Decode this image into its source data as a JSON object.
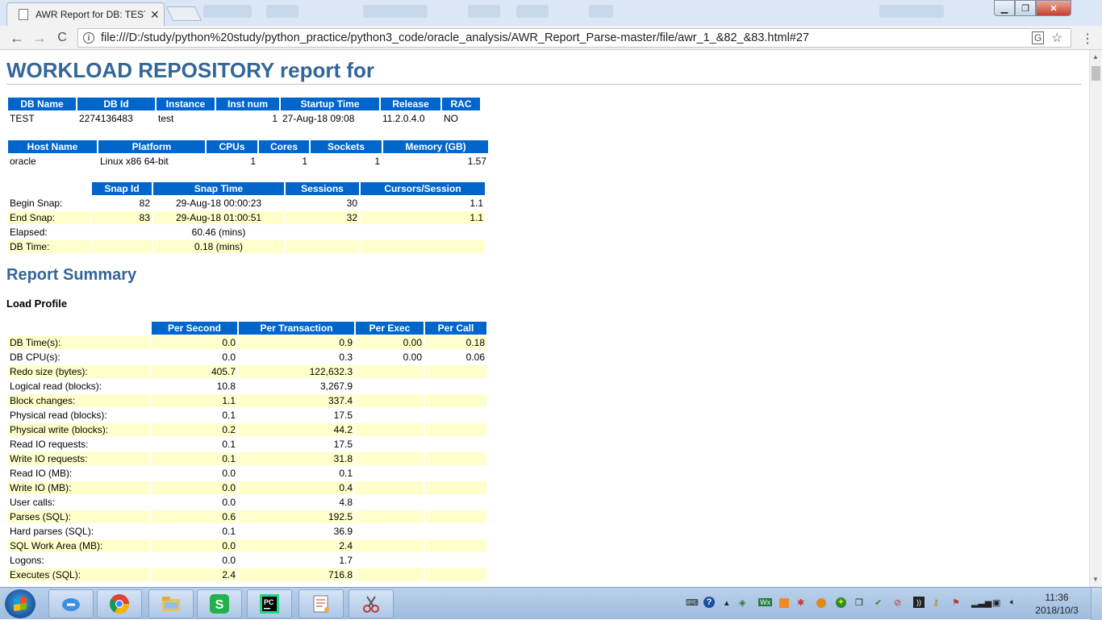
{
  "browser": {
    "tab_title": "AWR Report for DB: TEST",
    "tab_close": "✕",
    "url": "file:///D:/study/python%20study/python_practice/python3_code/oracle_analysis/AWR_Report_Parse-master/file/awr_1_&82_&83.html#27",
    "back": "←",
    "forward": "→",
    "reload": "C",
    "info": "i",
    "translate": "G",
    "star": "☆",
    "menu": "⋮",
    "minimize": "▁",
    "maximize": "❐",
    "close": "✕"
  },
  "report": {
    "title": "WORKLOAD REPOSITORY report for",
    "db_table": {
      "headers": [
        "DB Name",
        "DB Id",
        "Instance",
        "Inst num",
        "Startup Time",
        "Release",
        "RAC"
      ],
      "row": [
        "TEST",
        "2274136483",
        "test",
        "1",
        "27-Aug-18 09:08",
        "11.2.0.4.0",
        "NO"
      ]
    },
    "host_table": {
      "headers": [
        "Host Name",
        "Platform",
        "CPUs",
        "Cores",
        "Sockets",
        "Memory (GB)"
      ],
      "row": [
        "oracle",
        "Linux x86 64-bit",
        "1",
        "1",
        "1",
        "1.57"
      ]
    },
    "snap_table": {
      "headers": [
        "",
        "Snap Id",
        "Snap Time",
        "Sessions",
        "Cursors/Session"
      ],
      "rows": [
        [
          "Begin Snap:",
          "82",
          "29-Aug-18 00:00:23",
          "30",
          "1.1"
        ],
        [
          "End Snap:",
          "83",
          "29-Aug-18 01:00:51",
          "32",
          "1.1"
        ],
        [
          "Elapsed:",
          "",
          "60.46 (mins)",
          "",
          ""
        ],
        [
          "DB Time:",
          "",
          "0.18 (mins)",
          "",
          ""
        ]
      ]
    },
    "summary_title": "Report Summary",
    "load_profile_title": "Load Profile",
    "load_table": {
      "headers": [
        "",
        "Per Second",
        "Per Transaction",
        "Per Exec",
        "Per Call"
      ],
      "rows": [
        [
          "DB Time(s):",
          "0.0",
          "0.9",
          "0.00",
          "0.18"
        ],
        [
          "DB CPU(s):",
          "0.0",
          "0.3",
          "0.00",
          "0.06"
        ],
        [
          "Redo size (bytes):",
          "405.7",
          "122,632.3",
          "",
          ""
        ],
        [
          "Logical read (blocks):",
          "10.8",
          "3,267.9",
          "",
          ""
        ],
        [
          "Block changes:",
          "1.1",
          "337.4",
          "",
          ""
        ],
        [
          "Physical read (blocks):",
          "0.1",
          "17.5",
          "",
          ""
        ],
        [
          "Physical write (blocks):",
          "0.2",
          "44.2",
          "",
          ""
        ],
        [
          "Read IO requests:",
          "0.1",
          "17.5",
          "",
          ""
        ],
        [
          "Write IO requests:",
          "0.1",
          "31.8",
          "",
          ""
        ],
        [
          "Read IO (MB):",
          "0.0",
          "0.1",
          "",
          ""
        ],
        [
          "Write IO (MB):",
          "0.0",
          "0.4",
          "",
          ""
        ],
        [
          "User calls:",
          "0.0",
          "4.8",
          "",
          ""
        ],
        [
          "Parses (SQL):",
          "0.6",
          "192.5",
          "",
          ""
        ],
        [
          "Hard parses (SQL):",
          "0.1",
          "36.9",
          "",
          ""
        ],
        [
          "SQL Work Area (MB):",
          "0.0",
          "2.4",
          "",
          ""
        ],
        [
          "Logons:",
          "0.0",
          "1.7",
          "",
          ""
        ],
        [
          "Executes (SQL):",
          "2.4",
          "716.8",
          "",
          ""
        ]
      ]
    }
  },
  "taskbar": {
    "time": "11:36",
    "date": "2018/10/3",
    "apps": [
      "browser-sync-icon",
      "chrome-icon",
      "file-explorer-icon",
      "wps-icon",
      "pycharm-icon",
      "notepad-icon",
      "snipping-tool-icon"
    ]
  }
}
